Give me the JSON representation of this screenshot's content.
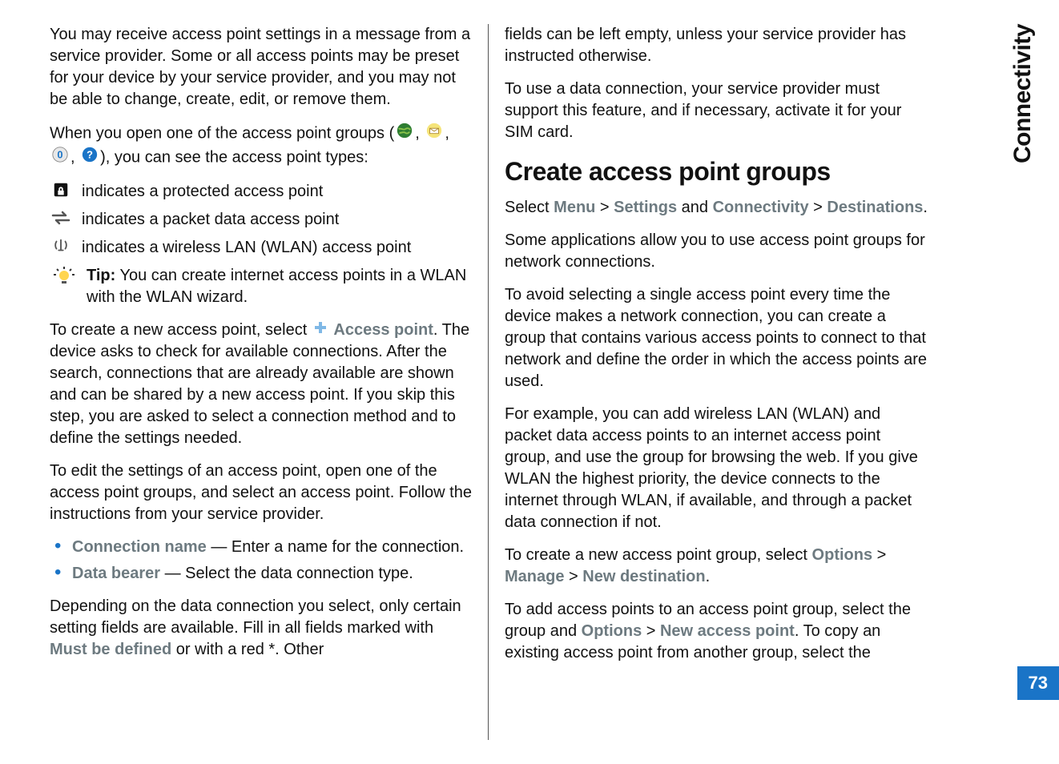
{
  "chapter": "Connectivity",
  "page_number": "73",
  "left": {
    "p1": "You may receive access point settings in a message from a service provider. Some or all access points may be preset for your device by your service provider, and you may not be able to change, create, edit, or remove them.",
    "p2_prefix": "When you open one of the access point groups (",
    "p2_mid1": ", ",
    "p2_mid2": ", ",
    "p2_mid3": ", ",
    "p2_suffix": "), you can see the access point types:",
    "ind_protected": "indicates a protected access point",
    "ind_packet": "indicates a packet data access point",
    "ind_wlan": "indicates a wireless LAN (WLAN) access point",
    "tip_label": "Tip:",
    "tip_text": " You can create internet access points in a WLAN with the WLAN wizard.",
    "p3_a": "To create a new access point, select ",
    "p3_ap": "Access point",
    "p3_b": ". The device asks to check for available connections. After the search, connections that are already available are shown and can be shared by a new access point. If you skip this step, you are asked to select a connection method and to define the settings needed.",
    "p4": "To edit the settings of an access point, open one of the access point groups, and select an access point. Follow the instructions from your service provider.",
    "li1_label": "Connection name",
    "li1_text": "  — Enter a name for the connection.",
    "li2_label": "Data bearer",
    "li2_text": "  — Select the data connection type.",
    "p5_a": "Depending on the data connection you select, only certain setting fields are available. Fill in all fields marked with ",
    "p5_mbd": "Must be defined",
    "p5_b": " or with a red *. Other"
  },
  "right": {
    "p1": "fields can be left empty, unless your service provider has instructed otherwise.",
    "p2": "To use a data connection, your service provider must support this feature, and if necessary, activate it for your SIM card.",
    "heading": "Create access point groups",
    "nav_select": "Select ",
    "nav_menu": "Menu",
    "nav_gt": " > ",
    "nav_settings": "Settings",
    "nav_and": " and ",
    "nav_conn": "Connectivity",
    "nav_dest": "Destinations",
    "nav_period": ".",
    "p3": "Some applications allow you to use access point groups for network connections.",
    "p4": "To avoid selecting a single access point every time the device makes a network connection, you can create a group that contains various access points to connect to that network and define the order in which the access points are used.",
    "p5": "For example, you can add wireless LAN (WLAN) and packet data access points to an internet access point group, and use the group for browsing the web. If you give WLAN the highest priority, the device connects to the internet through WLAN, if available, and through a packet data connection if not.",
    "p6_a": "To create a new access point group, select ",
    "p6_opts": "Options",
    "p6_manage": "Manage",
    "p6_newdest": "New destination",
    "p7_a": "To add access points to an access point group, select the group and ",
    "p7_opts": "Options",
    "p7_nap": "New access point",
    "p7_b": ". To copy an existing access point from another group, select the"
  }
}
